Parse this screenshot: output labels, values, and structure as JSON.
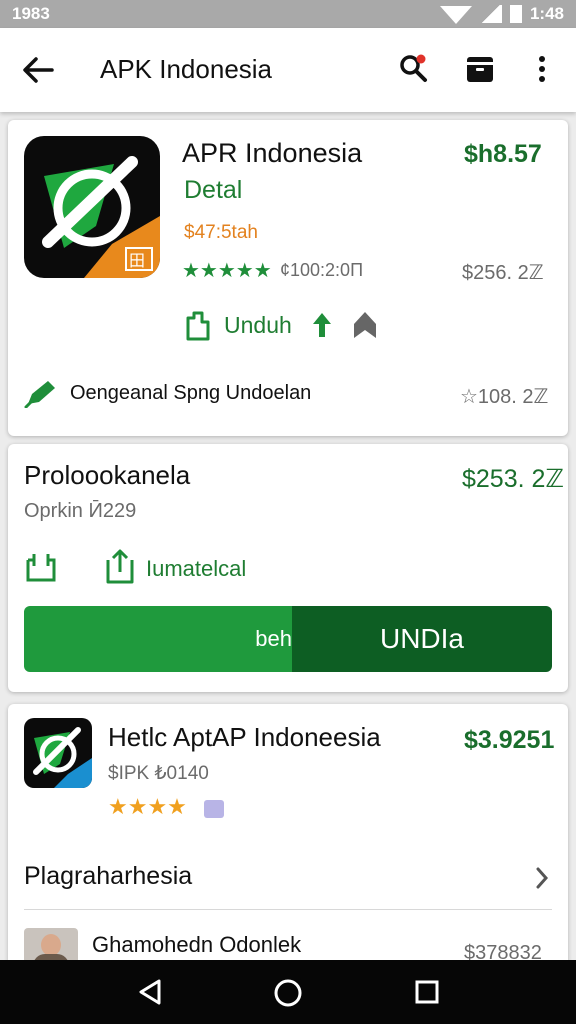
{
  "status_bar": {
    "time_left": "1983",
    "time_right": "1:48"
  },
  "app_bar": {
    "title": "APK Indonesia"
  },
  "featured": {
    "name": "APR Indonesia",
    "subtitle": "Detal",
    "price_orange": "$47:5tah",
    "rating_text": "¢100:2:0Π",
    "price_top": "$h8.57",
    "price_mid": "$256. 2ℤ",
    "download_label": "Unduh",
    "publisher_label": "Oengeanal Spng Undoelan",
    "price_bottom": "☆108. 2ℤ",
    "stars": "★★★★★"
  },
  "promo": {
    "title": "Proloookanela",
    "subtitle": "Oprkin Ӣ229",
    "price": "$253. 2ℤ",
    "action_label": "Iumatelcal",
    "button_left": "beh",
    "button_right": "UNDIa"
  },
  "list_item": {
    "name": "Hetlc AptAP Indoneesia",
    "subtitle": "$IPK ₺0140",
    "price": "$3.9251",
    "stars": "★★★★",
    "section_title": "Plagraharhesia",
    "user_name": "Ghamohedn Odonlek",
    "user_price": "$378832"
  },
  "colors": {
    "accent": "#1f9a3d",
    "accent_dark": "#0d5e23",
    "price": "#1a6e2c",
    "orange": "#e3821f"
  },
  "icons": [
    "back-arrow-icon",
    "search-icon",
    "store-icon",
    "more-vert-icon",
    "download-icon",
    "arrow-up-icon",
    "bookmark-icon",
    "pen-icon",
    "share-icon",
    "chevron-right-icon",
    "nav-back-icon",
    "nav-home-icon",
    "nav-recent-icon"
  ]
}
